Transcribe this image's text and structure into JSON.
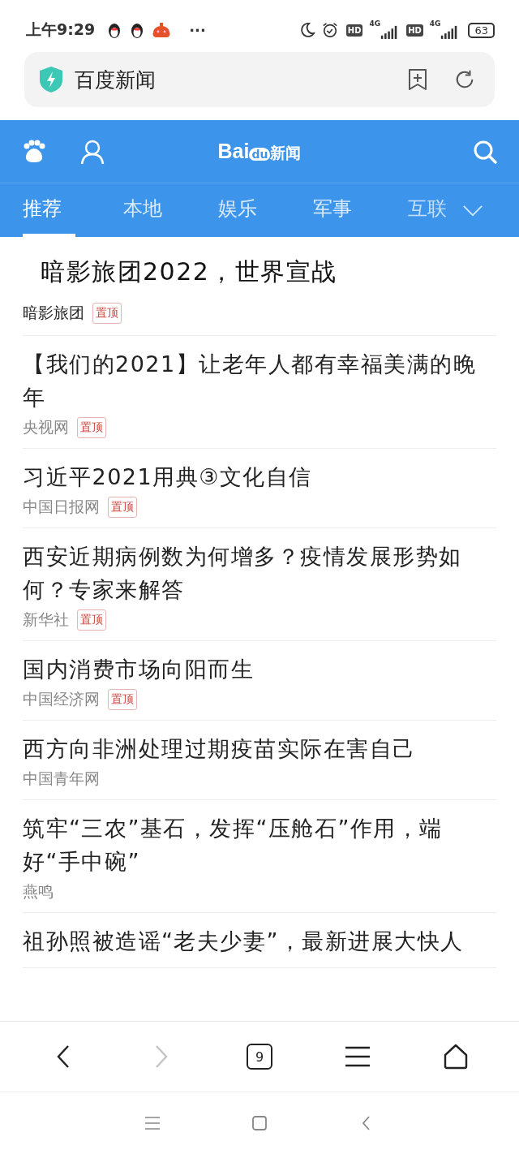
{
  "status_bar": {
    "time": "上午9:29",
    "more": "···",
    "sim_labels": [
      {
        "hd": "HD",
        "net": "4G"
      },
      {
        "hd": "HD",
        "net": "4G"
      }
    ],
    "battery": "63"
  },
  "address_bar": {
    "title": "百度新闻"
  },
  "header": {
    "logo_latin": "Bai",
    "logo_du": "du",
    "logo_cjk": "新闻"
  },
  "tabs": [
    {
      "label": "推荐",
      "selected": true
    },
    {
      "label": "本地",
      "selected": false
    },
    {
      "label": "娱乐",
      "selected": false
    },
    {
      "label": "军事",
      "selected": false
    },
    {
      "label": "互联",
      "selected": false
    }
  ],
  "articles": [
    {
      "kind": "featured",
      "title": "暗影旅团2022，世界宣战",
      "source": "暗影旅团",
      "badge": "置顶"
    },
    {
      "kind": "normal",
      "title": "【我们的2021】让老年人都有幸福美满的晚年",
      "source": "央视网",
      "badge": "置顶"
    },
    {
      "kind": "normal",
      "title": "习近平2021用典③文化自信",
      "source": "中国日报网",
      "badge": "置顶"
    },
    {
      "kind": "normal",
      "title": "西安近期病例数为何增多？疫情发展形势如何？专家来解答",
      "source": "新华社",
      "badge": "置顶"
    },
    {
      "kind": "normal",
      "title": "国内消费市场向阳而生",
      "source": "中国经济网",
      "badge": "置顶"
    },
    {
      "kind": "normal",
      "title": "西方向非洲处理过期疫苗实际在害自己",
      "source": "中国青年网"
    },
    {
      "kind": "normal",
      "title": "筑牢“三农”基石，发挥“压舱石”作用，端好“手中碗”",
      "source": "燕鸣"
    },
    {
      "kind": "normal",
      "title": "祖孙照被造谣“老夫少妻”，最新进展大快人"
    }
  ],
  "toolbar": {
    "back_disabled": false,
    "forward_disabled": true,
    "tab_count": "9"
  }
}
